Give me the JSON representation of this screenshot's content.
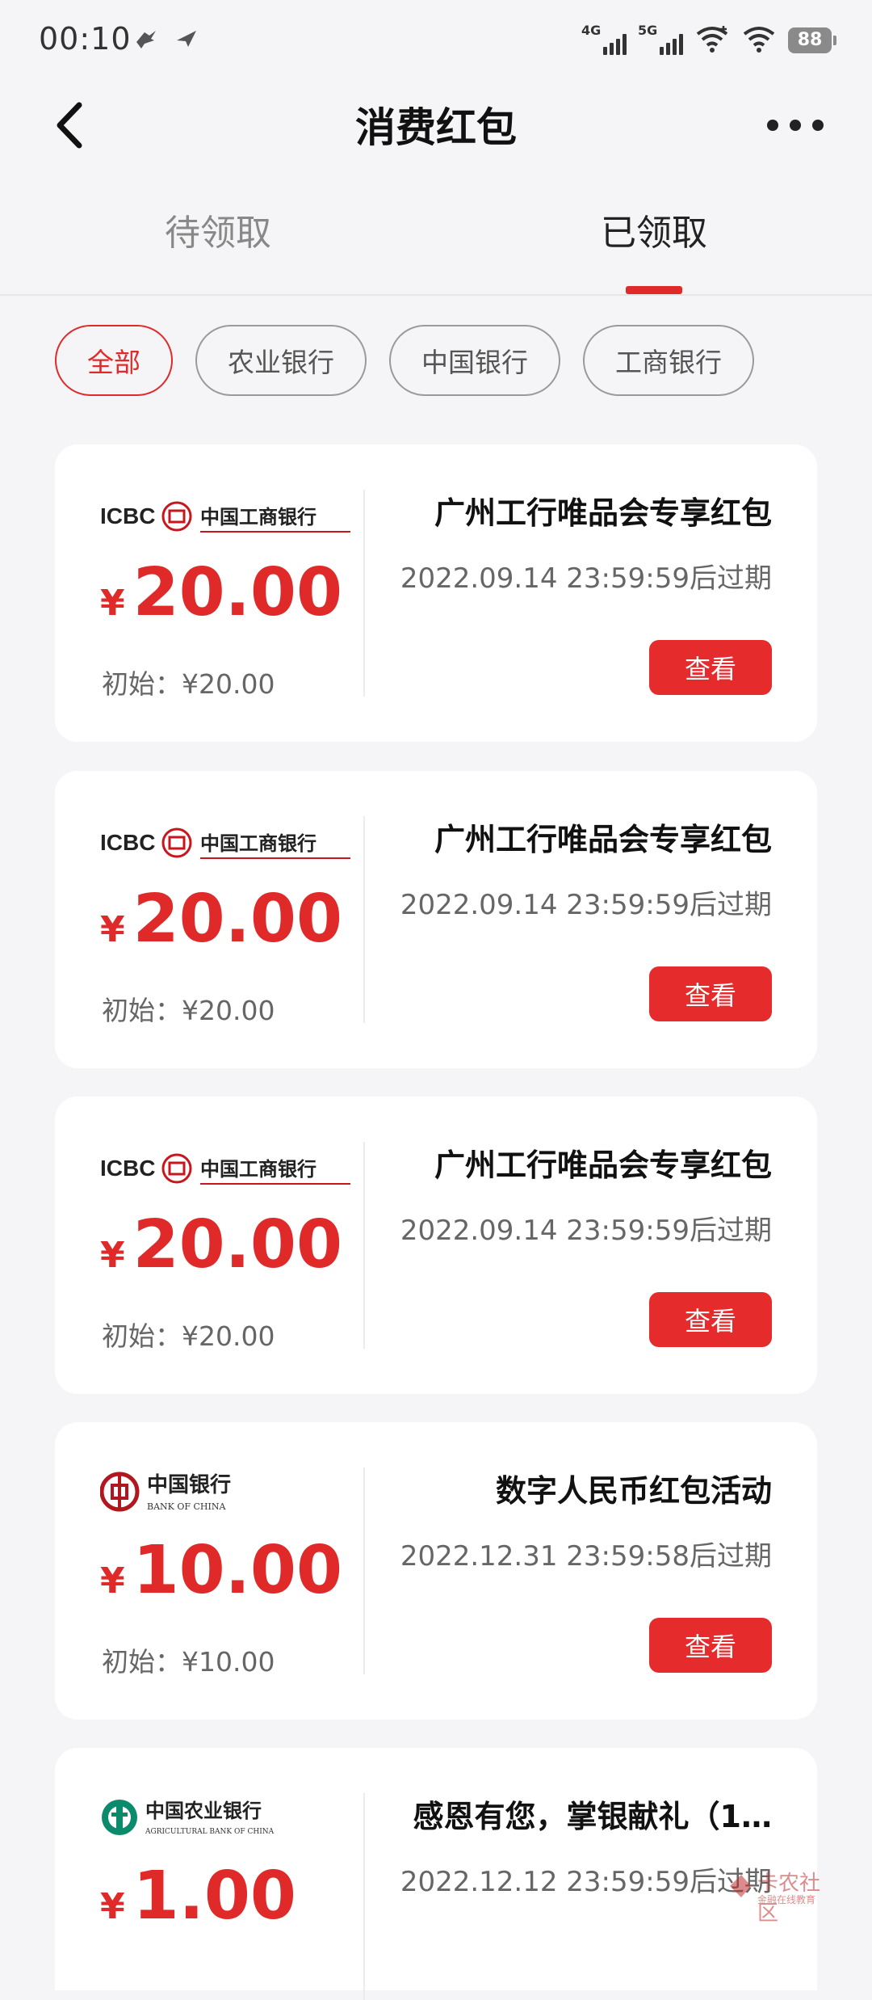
{
  "status_bar": {
    "time": "00:10",
    "signal1_label": "4G",
    "signal2_label": "5G",
    "battery": "88"
  },
  "nav": {
    "title": "消费红包"
  },
  "tabs": [
    {
      "label": "待领取",
      "active": false
    },
    {
      "label": "已领取",
      "active": true
    }
  ],
  "filters": [
    {
      "label": "全部",
      "active": true
    },
    {
      "label": "农业银行",
      "active": false
    },
    {
      "label": "中国银行",
      "active": false
    },
    {
      "label": "工商银行",
      "active": false
    }
  ],
  "cards": [
    {
      "bank": "icbc",
      "logo_text": "ICBC",
      "logo_name": "中国工商银行",
      "currency": "¥",
      "amount": "20.00",
      "initial": "初始：¥20.00",
      "name": "广州工行唯品会专享红包",
      "expire": "2022.09.14 23:59:59后过期",
      "button": "查看"
    },
    {
      "bank": "icbc",
      "logo_text": "ICBC",
      "logo_name": "中国工商银行",
      "currency": "¥",
      "amount": "20.00",
      "initial": "初始：¥20.00",
      "name": "广州工行唯品会专享红包",
      "expire": "2022.09.14 23:59:59后过期",
      "button": "查看"
    },
    {
      "bank": "icbc",
      "logo_text": "ICBC",
      "logo_name": "中国工商银行",
      "currency": "¥",
      "amount": "20.00",
      "initial": "初始：¥20.00",
      "name": "广州工行唯品会专享红包",
      "expire": "2022.09.14 23:59:59后过期",
      "button": "查看"
    },
    {
      "bank": "boc",
      "logo_name": "中国银行",
      "logo_sub": "BANK OF CHINA",
      "currency": "¥",
      "amount": "10.00",
      "initial": "初始：¥10.00",
      "name": "数字人民币红包活动",
      "expire": "2022.12.31 23:59:58后过期",
      "button": "查看"
    },
    {
      "bank": "abc",
      "logo_name": "中国农业银行",
      "logo_sub": "AGRICULTURAL BANK OF CHINA",
      "currency": "¥",
      "amount": "1.00",
      "name": "感恩有您，掌银献礼（1…",
      "expire": "2022.12.12 23:59:59后过期"
    }
  ],
  "watermark": {
    "title": "卡农社区",
    "subtitle": "金融在线教育"
  },
  "colors": {
    "accent": "#e02a2a",
    "background": "#f5f5f7",
    "card": "#ffffff"
  }
}
